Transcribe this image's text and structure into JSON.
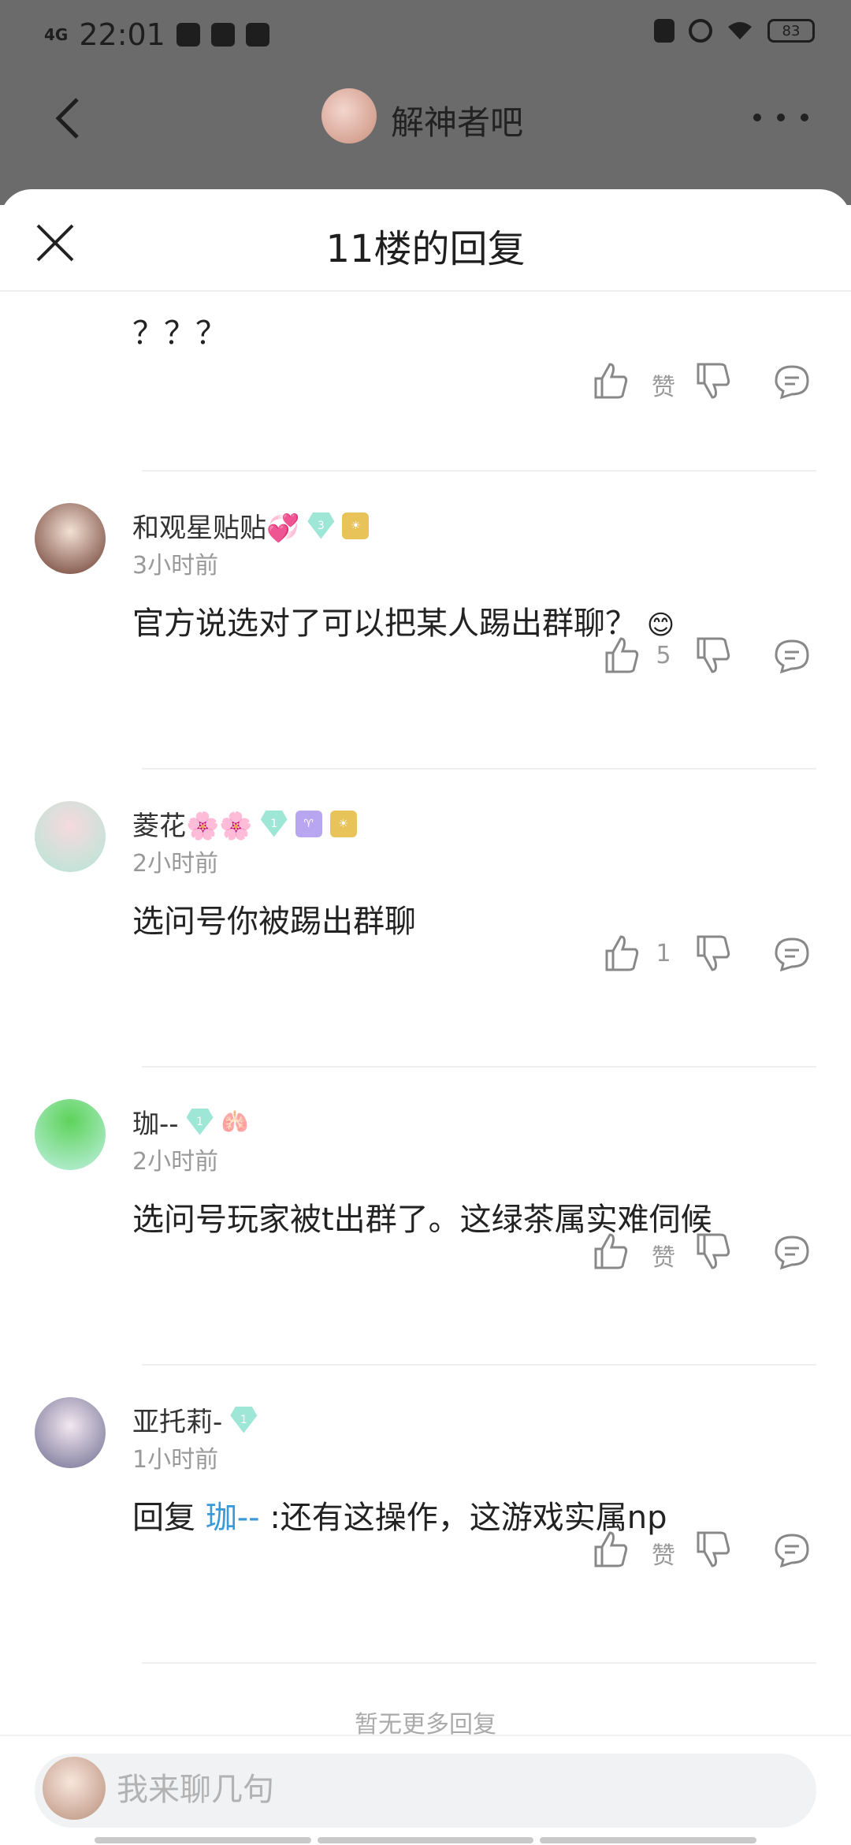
{
  "status_bar": {
    "network": "4G",
    "time": "22:01",
    "battery": "83"
  },
  "nav": {
    "forum_title": "解神者吧"
  },
  "sheet": {
    "title": "11楼的回复"
  },
  "posts": [
    {
      "content": "？？？",
      "like_count": "赞"
    },
    {
      "username": "和观星贴贴💞",
      "level_badge": "3",
      "time": "3小时前",
      "content": "官方说选对了可以把某人踢出群聊？",
      "content_emoji": "😊",
      "like_count": "5"
    },
    {
      "username": "菱花🌸🌸",
      "level_badge": "1",
      "time": "2小时前",
      "content": "选问号你被踢出群聊",
      "like_count": "1"
    },
    {
      "username": "珈--",
      "level_badge": "1",
      "time": "2小时前",
      "content": "选问号玩家被t出群了。这绿茶属实难伺候",
      "like_count": "赞"
    },
    {
      "username": "亚托莉-",
      "level_badge": "1",
      "time": "1小时前",
      "reply_prefix": "回复",
      "reply_mention": "珈--",
      "content": ":还有这操作，这游戏实属np",
      "like_count": "赞"
    }
  ],
  "footer": {
    "no_more": "暂无更多回复",
    "input_placeholder": "我来聊几句"
  },
  "colors": {
    "mention": "#3a9ad9",
    "dim_background": "#6b6b6b"
  },
  "icons": [
    "back-arrow-icon",
    "more-icon",
    "close-icon",
    "thumbs-up-icon",
    "thumbs-down-icon",
    "comment-icon"
  ]
}
